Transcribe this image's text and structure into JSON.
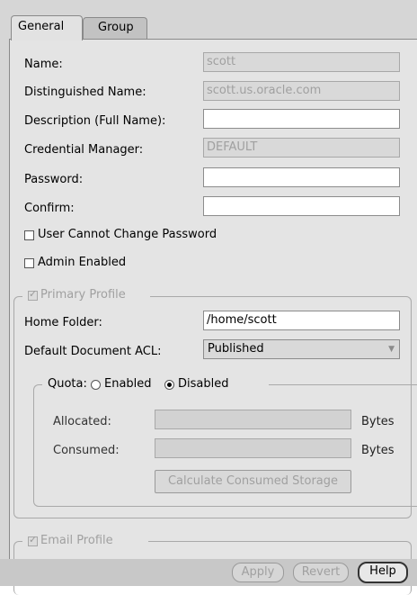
{
  "tabs": [
    {
      "label": "General"
    },
    {
      "label": "Group"
    }
  ],
  "fields": {
    "name": {
      "label": "Name:",
      "value": "scott"
    },
    "dn": {
      "label": "Distinguished Name:",
      "value": "scott.us.oracle.com"
    },
    "description": {
      "label": "Description (Full Name):",
      "value": ""
    },
    "credential": {
      "label": "Credential Manager:",
      "value": "DEFAULT"
    },
    "password": {
      "label": "Password:",
      "value": ""
    },
    "confirm": {
      "label": "Confirm:",
      "value": ""
    }
  },
  "checkboxes": {
    "cannot_change": {
      "label": "User Cannot Change Password",
      "checked": false
    },
    "admin": {
      "label": "Admin Enabled",
      "checked": false
    }
  },
  "primary_profile": {
    "title": "Primary Profile",
    "checked": true,
    "home_folder_label": "Home Folder:",
    "home_folder_value": "/home/scott",
    "acl_label": "Default Document ACL:",
    "acl_value": "Published"
  },
  "quota": {
    "label": "Quota:",
    "enabled_label": "Enabled",
    "disabled_label": "Disabled",
    "selected": "Disabled",
    "allocated_label": "Allocated:",
    "consumed_label": "Consumed:",
    "unit_label": "Bytes",
    "calc_button": "Calculate Consumed Storage"
  },
  "email_profile": {
    "title": "Email Profile",
    "checked": true
  },
  "buttons": {
    "apply": "Apply",
    "revert": "Revert",
    "help": "Help"
  }
}
